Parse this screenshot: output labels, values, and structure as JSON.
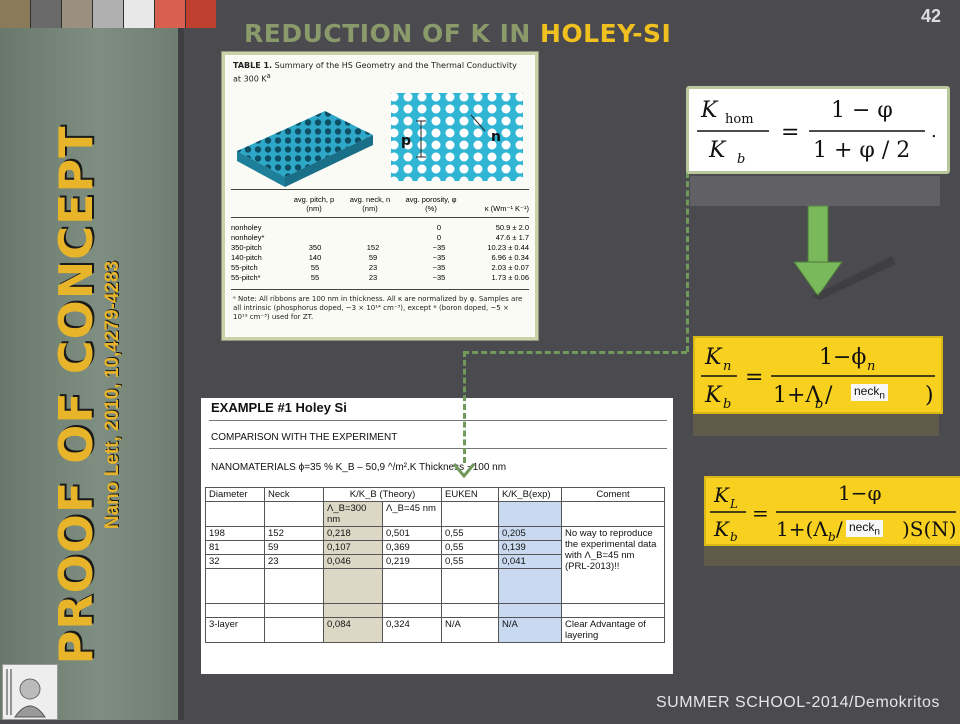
{
  "slide": {
    "title_prefix": "REDUCTION OF K IN ",
    "title_highlight": "HOLEY-SI",
    "page_number": "42",
    "footer": "SUMMER SCHOOL-2014/Demokritos",
    "vertical_title": "PROOF OF CONCEPT",
    "vertical_subtitle": "Nano Lett, 2010, 10,4279-4283"
  },
  "table1": {
    "caption_label": "TABLE 1.",
    "caption_text": "Summary of the HS Geometry and the Thermal Conductivity at 300 K",
    "pitch_symbol": "p",
    "neck_symbol": "n",
    "headers": [
      "avg. pitch, p (nm)",
      "avg. neck, n (nm)",
      "avg. porosity, φ (%)",
      "κ (Wm⁻¹ K⁻¹)"
    ],
    "rows": [
      [
        "nonholey",
        "",
        "",
        "0",
        "50.9 ± 2.0"
      ],
      [
        "nonholey*",
        "",
        "",
        "0",
        "47.6 ± 1.7"
      ],
      [
        "350-pitch",
        "350",
        "152",
        "~35",
        "10.23 ± 0.44"
      ],
      [
        "140-pitch",
        "140",
        "59",
        "~35",
        "6.96 ± 0.34"
      ],
      [
        "55-pitch",
        "55",
        "23",
        "~35",
        "2.03 ± 0.07"
      ],
      [
        "55-pitch*",
        "55",
        "23",
        "~35",
        "1.73 ± 0.06"
      ]
    ],
    "note": "ᵃ Note: All ribbons are 100 nm in thickness. All κ are normalized by φ. Samples are all intrinsic (phosphorus doped, ~3 × 10¹⁴ cm⁻³), except * (boron doped, ~5 × 10¹⁹ cm⁻³) used for ZT."
  },
  "example": {
    "title": "EXAMPLE #1   Holey Si",
    "subtitle": "COMPARISON WITH THE EXPERIMENT",
    "nanomaterials": "NANOMATERIALS   ϕ=35 %   K_B – 50,9 ^/m².K  Thickness ~100 nm",
    "headers": [
      "Diameter",
      "Neck",
      "K/K_B (Theory)",
      "EUKEN",
      "K/K_B(exp)",
      "Coment"
    ],
    "subheaders": [
      "Λ_B=300 nm",
      "Λ_B=45 nm"
    ],
    "rows": [
      [
        "198",
        "152",
        "0,218",
        "0,501",
        "0,55",
        "0,205"
      ],
      [
        "81",
        "59",
        "0,107",
        "0,369",
        "0,55",
        "0,139"
      ],
      [
        "32",
        "23",
        "0,046",
        "0,219",
        "0,55",
        "0,041"
      ]
    ],
    "comment_main": "No way to reproduce the experimental data with Λ_B=45 nm (PRL-2013)!!",
    "layer_row": [
      "3-layer",
      "",
      "0,084",
      "0,324",
      "N/A",
      "N/A"
    ],
    "comment_layer": "Clear Advantage of layering"
  },
  "formulas": {
    "f1": {
      "lhs_num": "K",
      "lhs_num_sub": "hom",
      "lhs_den": "K",
      "lhs_den_sub": "b",
      "num": "1 − φ",
      "den": "1 + φ / 2",
      "tail": "."
    },
    "f2": {
      "lhs_num": "K",
      "lhs_num_sub": "n",
      "lhs_den": "K",
      "lhs_den_sub": "b",
      "num": "1−ϕ",
      "num_sub": "n",
      "den": "1+Λ",
      "den_sub": "b",
      "den_tail": " / ",
      "close": ")",
      "neck": "neck",
      "neck_sub": "n"
    },
    "f3": {
      "lhs_num": "K",
      "lhs_num_sub": "L",
      "lhs_den": "K",
      "lhs_den_sub": "b",
      "num": "1−φ",
      "den": "1+(Λ",
      "den_sub": "b",
      "den_tail": " / ",
      "close": ")S(N)",
      "neck": "neck",
      "neck_sub": "n"
    }
  },
  "colors": {
    "accent_gold": "#f0c020",
    "formula_yellow": "#f7d020",
    "connector_green": "#6f9a5c",
    "arrow_green": "#7ab85c"
  },
  "icons": [
    "down-arrow-icon",
    "demokritos-seal-icon"
  ]
}
